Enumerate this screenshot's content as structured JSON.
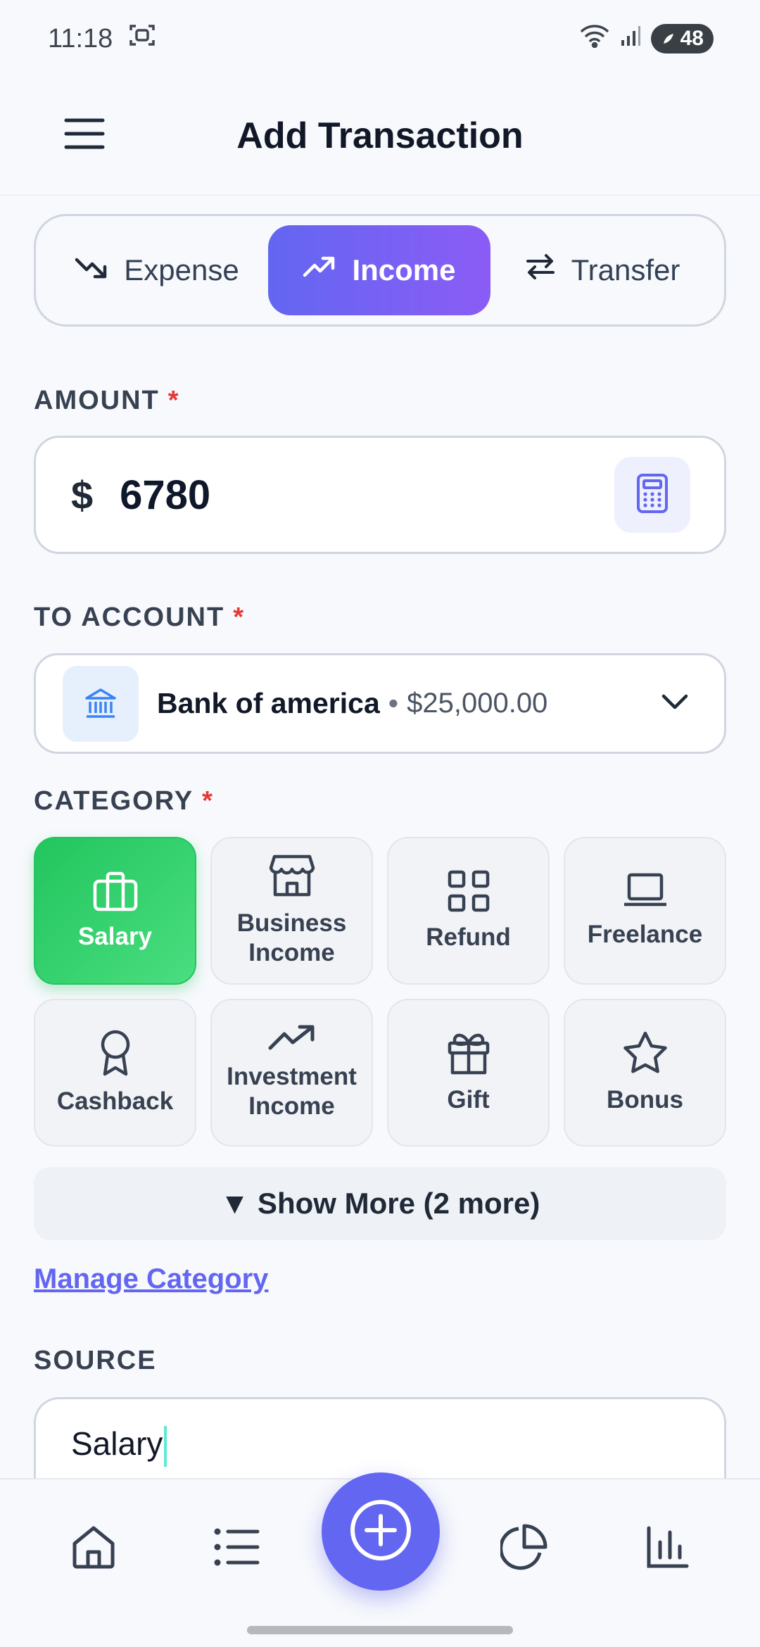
{
  "status_bar": {
    "time": "11:18",
    "battery": "48",
    "icons": [
      "screenshot-icon",
      "wifi-icon",
      "signal-icon",
      "battery-icon"
    ]
  },
  "header": {
    "title": "Add Transaction",
    "menu_icon": "hamburger-menu-icon"
  },
  "type_tabs": [
    {
      "label": "Expense",
      "icon": "trending-down-icon",
      "active": false
    },
    {
      "label": "Income",
      "icon": "trending-up-icon",
      "active": true
    },
    {
      "label": "Transfer",
      "icon": "swap-arrows-icon",
      "active": false
    }
  ],
  "amount": {
    "label": "AMOUNT",
    "required_mark": "*",
    "currency_symbol": "$",
    "value": "6780",
    "calc_icon": "calculator-icon"
  },
  "to_account": {
    "label": "TO ACCOUNT",
    "required_mark": "*",
    "account_name": "Bank of america",
    "separator": "•",
    "balance": "$25,000.00",
    "icon": "bank-icon"
  },
  "category": {
    "label": "CATEGORY",
    "required_mark": "*",
    "items": [
      {
        "label": "Salary",
        "icon": "briefcase-icon",
        "active": true
      },
      {
        "label": "Business Income",
        "icon": "store-icon",
        "active": false
      },
      {
        "label": "Refund",
        "icon": "grid-icon",
        "active": false
      },
      {
        "label": "Freelance",
        "icon": "laptop-icon",
        "active": false
      },
      {
        "label": "Cashback",
        "icon": "award-icon",
        "active": false
      },
      {
        "label": "Investment Income",
        "icon": "trending-up-icon",
        "active": false
      },
      {
        "label": "Gift",
        "icon": "gift-icon",
        "active": false
      },
      {
        "label": "Bonus",
        "icon": "star-icon",
        "active": false
      }
    ],
    "show_more": "▼ Show More (2 more)"
  },
  "manage_category": "Manage Category",
  "source": {
    "label": "SOURCE",
    "value": "Salary"
  },
  "bottom_nav": {
    "items": [
      "home-icon",
      "list-icon",
      "add-circle-icon",
      "pie-chart-icon",
      "bar-chart-icon"
    ]
  },
  "colors": {
    "accent": "#6366f1",
    "accent_gradient_end": "#8b5cf6",
    "category_active": "#22c55e",
    "required": "#e53935"
  }
}
